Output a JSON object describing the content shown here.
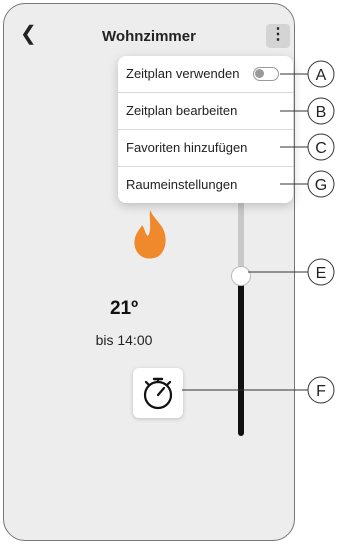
{
  "header": {
    "back_icon": "chevron-left-icon",
    "title": "Wohnzimmer",
    "menu_icon": "kebab-menu-icon"
  },
  "menu": {
    "items": [
      {
        "label": "Zeitplan verwenden",
        "has_toggle": true,
        "toggle_on": false
      },
      {
        "label": "Zeitplan bearbeiten"
      },
      {
        "label": "Favoriten hinzufügen"
      },
      {
        "label": "Raumeinstellungen"
      }
    ]
  },
  "heating": {
    "icon": "flame-icon",
    "flame_color": "#f0892b",
    "temperature": "21º",
    "until": "bis 14:00",
    "timer_icon": "stopwatch-icon",
    "slider_level": 0.34
  },
  "callouts": {
    "labels": [
      "A",
      "B",
      "C",
      "G",
      "E",
      "F"
    ]
  }
}
